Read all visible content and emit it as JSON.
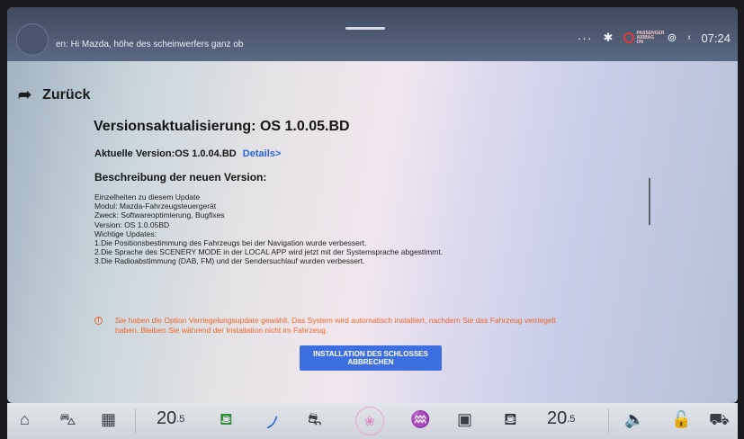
{
  "topbar": {
    "voice_text": "en: Hi Mazda, höhe des scheinwerfers ganz ob",
    "more": "···",
    "bluetooth_icon": "bluetooth-icon",
    "passenger_airbag_text": "PASSENGER AIRBAG ON",
    "signal_icon": "signal-icon",
    "time": "07:24"
  },
  "nav": {
    "back_label": "Zurück"
  },
  "update": {
    "title": "Versionsaktualisierung: OS 1.0.05.BD",
    "current_version": "Aktuelle Version:OS 1.0.04.BD",
    "details_link": "Details>",
    "description_heading": "Beschreibung der neuen Version:",
    "description_lines": [
      "Einzelheiten zu diesem Update",
      "Modul: Mazda-Fahrzeugsteuergerät",
      "Zweck: Softwareoptimierung, Bugfixes",
      "Version: OS 1.0.05BD",
      "Wichtige Updates:",
      "1.Die Positionsbestimmung des Fahrzeugs bei der Navigation wurde verbessert.",
      "2.Die Sprache des SCENERY MODE in der LOCAL APP wird jetzt mit der Systemsprache abgestimmt.",
      "3.Die Radioabstimmung (DAB, FM) und der Sendersuchlauf wurden verbessert."
    ],
    "warning_line1": "Sie haben die Option Verriegelungsupdate gewählt. Das System wird automatisch installiert, nachdem Sie das Fahrzeug verriegelt",
    "warning_line2": "haben. Bleiben Sie während der Installation nicht im Fahrzeug.",
    "cancel_button_line1": "INSTALLATION DES SCHLOSSES",
    "cancel_button_line2": "ABBRECHEN"
  },
  "dock": {
    "temp_left": "20",
    "temp_left_decimal": ".5",
    "temp_right": "20",
    "temp_right_decimal": ".5",
    "icons": [
      "home-icon",
      "car-icon",
      "apps-grid-icon",
      "seat-heat-driver-icon",
      "wiper-icon",
      "recirculation-icon",
      "fan-icon",
      "front-defrost-icon",
      "rear-defrost-icon",
      "seat-heat-passenger-icon",
      "volume-icon",
      "lock-icon",
      "car-profile-icon"
    ]
  }
}
